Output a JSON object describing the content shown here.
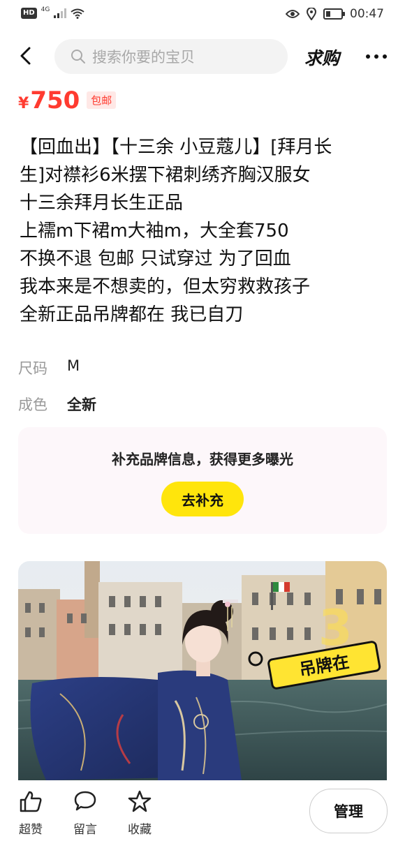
{
  "status_bar": {
    "hd": "HD",
    "signal": "4G",
    "time": "00:47"
  },
  "header": {
    "search_placeholder": "搜索你要的宝贝",
    "qiugou": "求购"
  },
  "price": {
    "currency": "¥",
    "amount": "750",
    "tag": "包邮"
  },
  "description": [
    "【回血出】【十三余 小豆蔻儿】[拜月长",
    "生]对襟衫6米摆下裙刺绣齐胸汉服女",
    "十三余拜月长生正品",
    "上襦m下裙m大袖m，大全套750",
    "不换不退      包邮     只试穿过  为了回血",
    "我本来是不想卖的，但太穷救救孩子",
    "全新正品吊牌都在  我已自刀"
  ],
  "attributes": {
    "size": {
      "key": "尺码",
      "value": "M"
    },
    "condition": {
      "key": "成色",
      "value": "全新"
    }
  },
  "brand_card": {
    "text": "补充品牌信息，获得更多曝光",
    "button": "去补充"
  },
  "photo": {
    "sticker_text": "吊牌在"
  },
  "bottom_bar": {
    "like": "超赞",
    "comment": "留言",
    "favorite": "收藏",
    "manage": "管理"
  }
}
